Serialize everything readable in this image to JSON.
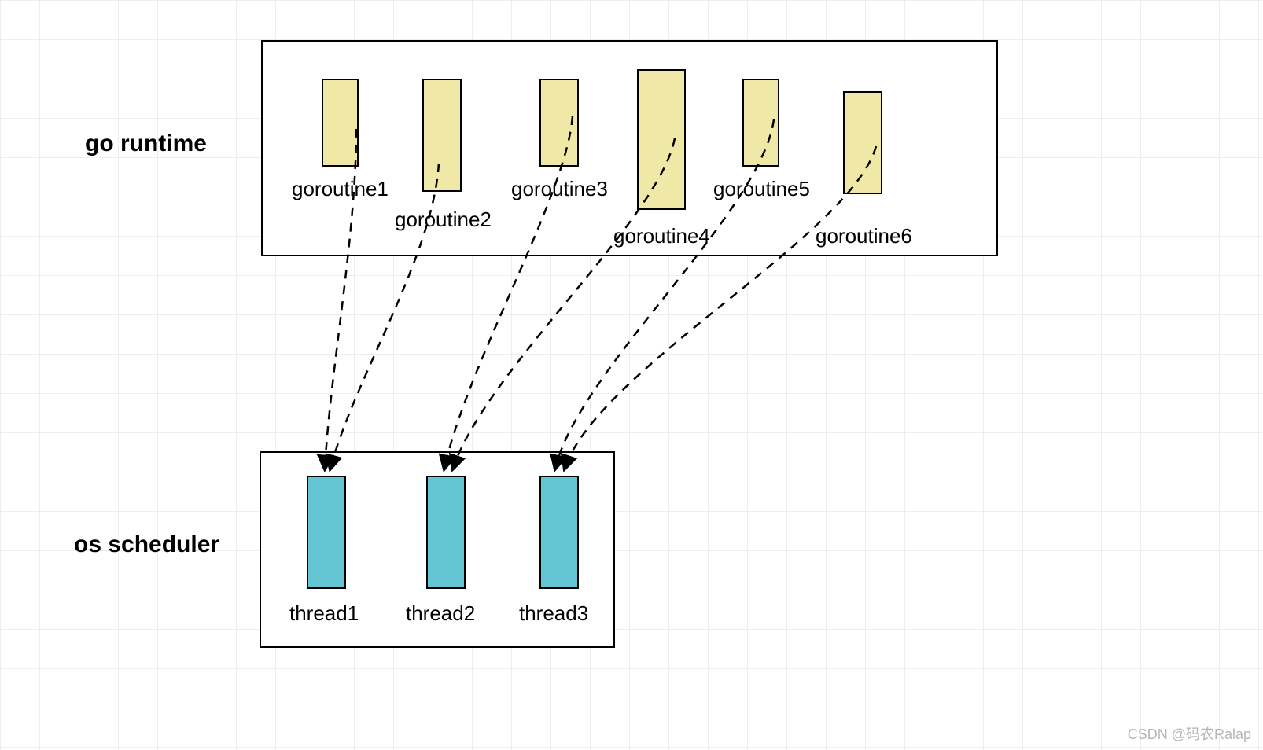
{
  "labels": {
    "runtime": "go runtime",
    "scheduler": "os scheduler"
  },
  "goroutines": {
    "g1": "goroutine1",
    "g2": "goroutine2",
    "g3": "goroutine3",
    "g4": "goroutine4",
    "g5": "goroutine5",
    "g6": "goroutine6"
  },
  "threads": {
    "t1": "thread1",
    "t2": "thread2",
    "t3": "thread3"
  },
  "watermark": "CSDN @码农Ralap",
  "chart_data": {
    "type": "diagram",
    "description": "Go runtime goroutines mapped onto OS scheduler threads (M:N scheduling)",
    "top_group": {
      "title": "go runtime",
      "items": [
        "goroutine1",
        "goroutine2",
        "goroutine3",
        "goroutine4",
        "goroutine5",
        "goroutine6"
      ]
    },
    "bottom_group": {
      "title": "os scheduler",
      "items": [
        "thread1",
        "thread2",
        "thread3"
      ]
    },
    "mappings": [
      {
        "from": "goroutine1",
        "to": "thread1"
      },
      {
        "from": "goroutine2",
        "to": "thread1"
      },
      {
        "from": "goroutine3",
        "to": "thread2"
      },
      {
        "from": "goroutine4",
        "to": "thread2"
      },
      {
        "from": "goroutine5",
        "to": "thread3"
      },
      {
        "from": "goroutine6",
        "to": "thread3"
      }
    ]
  }
}
